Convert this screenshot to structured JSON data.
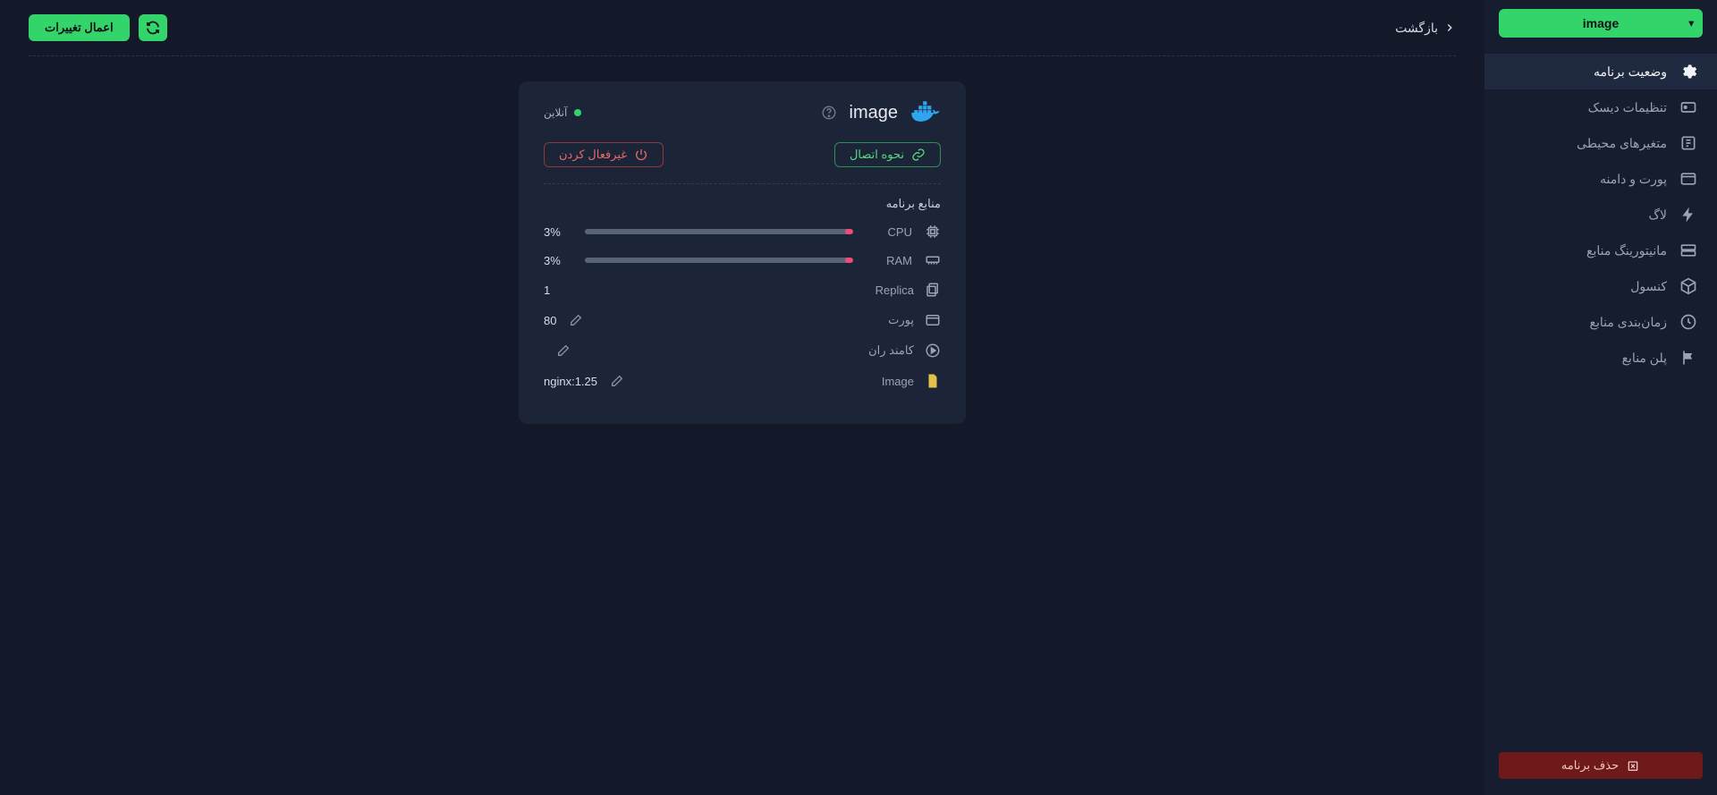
{
  "sidebar": {
    "selected_app": "image",
    "nav": [
      {
        "label": "وضعیت برنامه",
        "active": true
      },
      {
        "label": "تنظیمات دیسک",
        "active": false
      },
      {
        "label": "متغیرهای محیطی",
        "active": false
      },
      {
        "label": "پورت و دامنه",
        "active": false
      },
      {
        "label": "لاگ",
        "active": false
      },
      {
        "label": "مانیتورینگ منابع",
        "active": false
      },
      {
        "label": "کنسول",
        "active": false
      },
      {
        "label": "زمان‌بندی منابع",
        "active": false
      },
      {
        "label": "پلن منابع",
        "active": false
      }
    ],
    "delete_label": "حذف برنامه"
  },
  "topbar": {
    "apply_label": "اعمال تغییرات",
    "back_label": "بازگشت"
  },
  "card": {
    "title": "image",
    "status_label": "آنلاین",
    "connect_label": "نحوه اتصال",
    "disable_label": "غیرفعال کردن",
    "resources_title": "منابع برنامه",
    "cpu": {
      "label": "CPU",
      "value": "3%",
      "pct": 3
    },
    "ram": {
      "label": "RAM",
      "value": "3%",
      "pct": 3
    },
    "replica": {
      "label": "Replica",
      "value": "1"
    },
    "port": {
      "label": "پورت",
      "value": "80"
    },
    "command": {
      "label": "کامند ران",
      "value": ""
    },
    "image": {
      "label": "Image",
      "value": "nginx:1.25"
    }
  }
}
